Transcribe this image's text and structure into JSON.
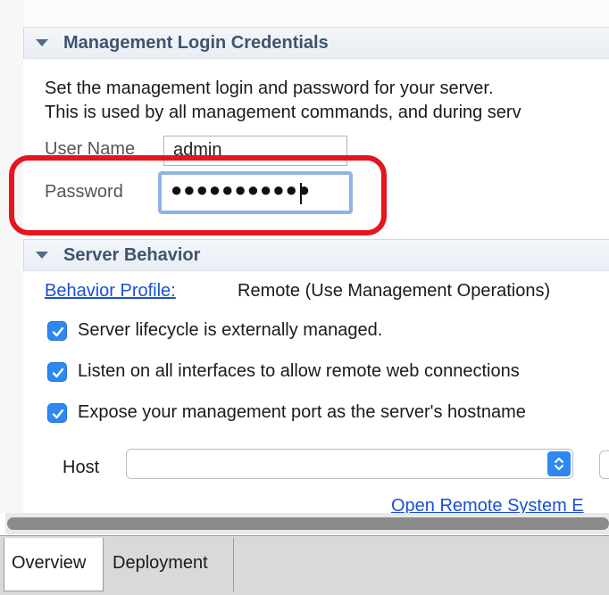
{
  "credentials_section": {
    "title": "Management Login Credentials",
    "description_line1": "Set the management login and password for your server.",
    "description_line2": "This is used by all management commands, and during serv",
    "username_label": "User Name",
    "username_value": "admin",
    "password_label": "Password",
    "password_value": "●●●●●●●●●●●"
  },
  "behavior_section": {
    "title": "Server Behavior",
    "profile_link": "Behavior Profile:",
    "profile_value": "Remote (Use Management Operations)",
    "checkboxes": [
      {
        "label": "Server lifecycle is externally managed.",
        "checked": true
      },
      {
        "label": "Listen on all interfaces to allow remote web connections",
        "checked": true
      },
      {
        "label": "Expose your management port as the server's hostname",
        "checked": true
      }
    ],
    "host_label": "Host",
    "host_value": "",
    "open_remote_link": "Open Remote System E"
  },
  "tabs": [
    {
      "label": "Overview",
      "active": true
    },
    {
      "label": "Deployment",
      "active": false
    }
  ],
  "colors": {
    "accent": "#2e88f0",
    "highlight": "#e5141e",
    "link": "#1a4fd6",
    "section_title": "#3f5470"
  }
}
